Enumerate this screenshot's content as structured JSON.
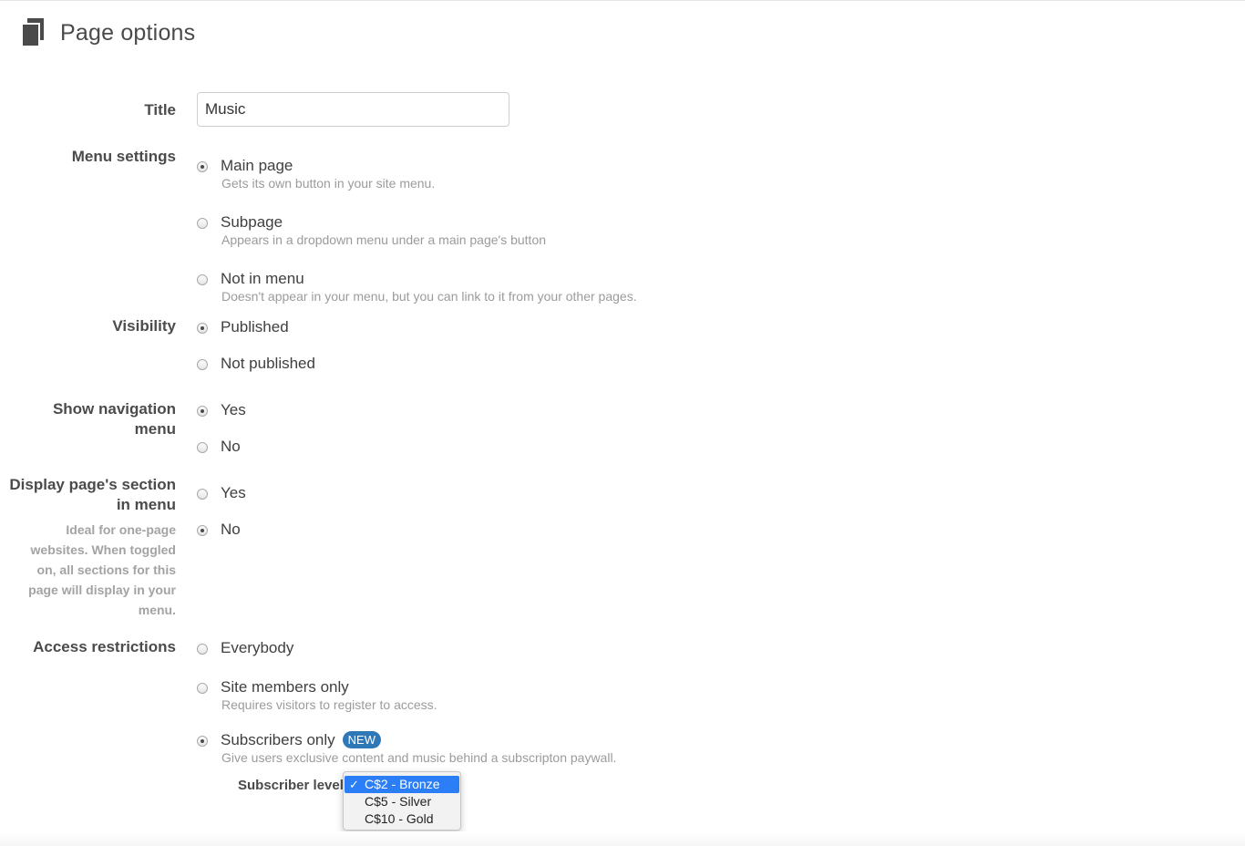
{
  "header": {
    "title": "Page options",
    "icon": "pages-icon"
  },
  "title_field": {
    "label": "Title",
    "value": "Music"
  },
  "menu_settings": {
    "label": "Menu settings",
    "options": [
      {
        "label": "Main page",
        "desc": "Gets its own button in your site menu.",
        "checked": true
      },
      {
        "label": "Subpage",
        "desc": "Appears in a dropdown menu under a main page's button",
        "checked": false
      },
      {
        "label": "Not in menu",
        "desc": "Doesn't appear in your menu, but you can link to it from your other pages.",
        "checked": false
      }
    ]
  },
  "visibility": {
    "label": "Visibility",
    "options": [
      {
        "label": "Published",
        "checked": true
      },
      {
        "label": "Not published",
        "checked": false
      }
    ]
  },
  "show_nav": {
    "label_line1": "Show navigation",
    "label_line2": "menu",
    "options": [
      {
        "label": "Yes",
        "checked": true
      },
      {
        "label": "No",
        "checked": false
      }
    ]
  },
  "display_section": {
    "label_line1": "Display page's section",
    "label_line2": "in menu",
    "help": [
      "Ideal for one-page",
      "websites. When toggled",
      "on, all sections for this",
      "page will display in your",
      "menu."
    ],
    "options": [
      {
        "label": "Yes",
        "checked": false
      },
      {
        "label": "No",
        "checked": true
      }
    ]
  },
  "access": {
    "label": "Access restrictions",
    "options": [
      {
        "label": "Everybody",
        "checked": false
      },
      {
        "label": "Site members only",
        "desc": "Requires visitors to register to access.",
        "checked": false
      },
      {
        "label": "Subscribers only",
        "badge": "NEW",
        "desc": "Give users exclusive content and music behind a subscripton paywall.",
        "checked": true
      }
    ],
    "subscriber_level": {
      "label": "Subscriber level",
      "options": [
        "C$2 - Bronze",
        "C$5 - Silver",
        "C$10 - Gold"
      ],
      "selected": "C$2 - Bronze",
      "check": "✓"
    }
  },
  "colors": {
    "accent": "#2b7ef5",
    "badge": "#2f78b7",
    "label": "#4b4b4b",
    "muted": "#9b9b9b"
  }
}
